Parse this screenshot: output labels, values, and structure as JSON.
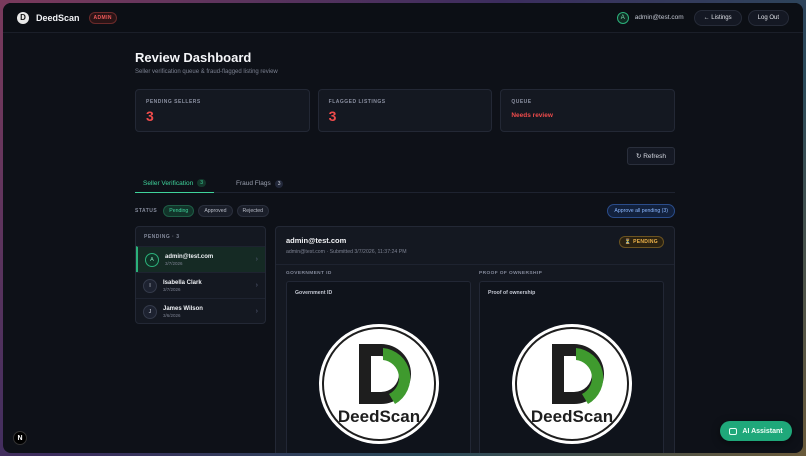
{
  "topbar": {
    "brand_initial": "D",
    "brand_name": "DeedScan",
    "admin_badge": "ADMIN",
    "user_initial": "A",
    "user_email": "admin@test.com",
    "listings_label": "← Listings",
    "logout_label": "Log Out"
  },
  "header": {
    "title": "Review Dashboard",
    "subtitle": "Seller verification queue & fraud-flagged listing review"
  },
  "stats": {
    "pending_label": "PENDING SELLERS",
    "pending_value": "3",
    "flagged_label": "FLAGGED LISTINGS",
    "flagged_value": "3",
    "queue_label": "QUEUE",
    "queue_value": "Needs review"
  },
  "refresh_label": "↻ Refresh",
  "tabs": [
    {
      "label": "Seller Verification",
      "count": "3"
    },
    {
      "label": "Fraud Flags",
      "count": "3"
    }
  ],
  "filters": {
    "label": "STATUS",
    "options": [
      "Pending",
      "Approved",
      "Rejected"
    ],
    "approve_all": "Approve all pending (3)"
  },
  "list": {
    "header": "PENDING · 3",
    "items": [
      {
        "initial": "A",
        "name": "admin@test.com",
        "date": "3/7/2026"
      },
      {
        "initial": "I",
        "name": "Isabella Clark",
        "date": "3/7/2026"
      },
      {
        "initial": "J",
        "name": "James Wilson",
        "date": "3/6/2026"
      }
    ]
  },
  "detail": {
    "email": "admin@test.com",
    "meta": "admin@test.com · Submitted 3/7/2026, 11:37:24 PM",
    "status_badge": "⏳ PENDING",
    "gov_label": "GOVERNMENT ID",
    "gov_title": "Government ID",
    "proof_label": "PROOF OF OWNERSHIP",
    "proof_title": "Proof of ownership",
    "logo_text": "DeedScan",
    "logo_letter": "D"
  },
  "misc": {
    "n_badge": "N",
    "ai_label": "AI Assistant"
  },
  "colors": {
    "accent_green": "#3fd39b",
    "alert_red": "#ef4b4b",
    "pending_amber": "#f0b44a",
    "logo_green": "#3f9a2e"
  }
}
